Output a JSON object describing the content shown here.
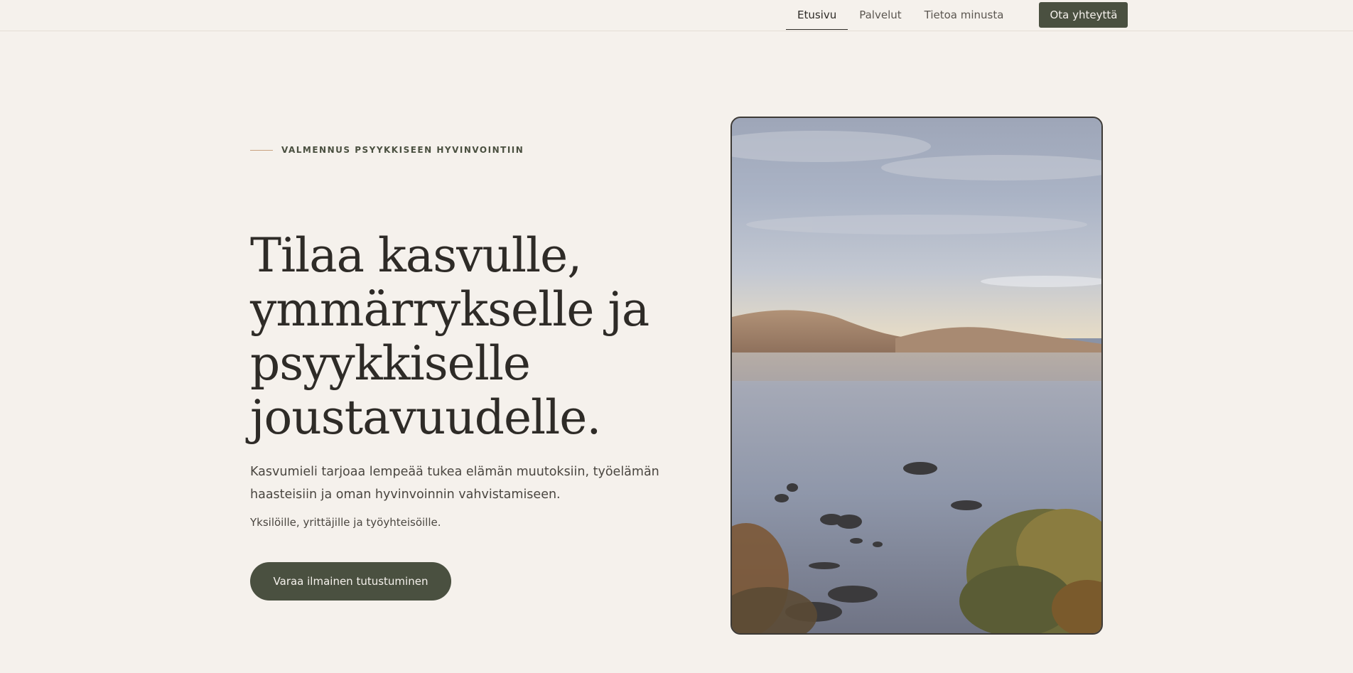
{
  "nav": {
    "items": [
      {
        "label": "Etusivu",
        "active": true
      },
      {
        "label": "Palvelut",
        "active": false
      },
      {
        "label": "Tietoa minusta",
        "active": false
      }
    ],
    "cta_label": "Ota yhteyttä"
  },
  "hero": {
    "eyebrow": "VALMENNUS PSYYKKISEEN HYVINVOINTIIN",
    "headline_lines": [
      "Tilaa kasvulle,",
      "ymmärrykselle ja",
      "psyykkiselle",
      "joustavuudelle."
    ],
    "lead": "Kasvumieli tarjoaa lempeää tukea elämän muutoksiin, työelämän haasteisiin ja oman hyvinvoinnin vahvistamiseen.",
    "sub": "Yksilöille, yrittäjille ja työyhteisöille.",
    "button_label": "Varaa ilmainen tutustuminen"
  },
  "colors": {
    "background": "#f5f1ec",
    "accent": "#4a5040",
    "eyebrow_line": "#c9a17f",
    "text": "#2e2b27"
  }
}
